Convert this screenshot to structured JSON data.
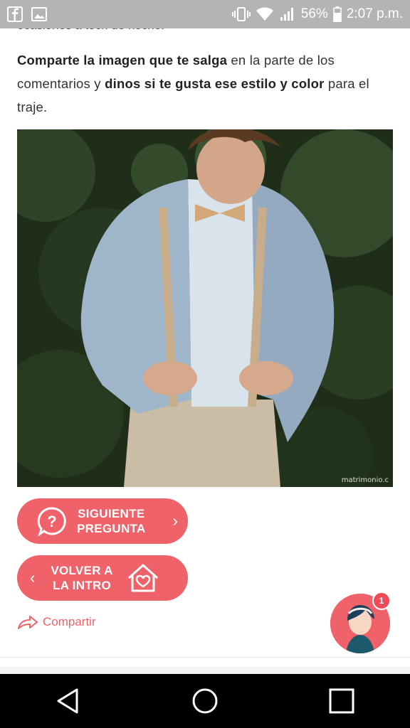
{
  "status_bar": {
    "network_percent": "56%",
    "time": "2:07 p.m."
  },
  "article": {
    "peek_text": "ocasiones a tech de noche.",
    "paragraph": {
      "part1_bold": "Comparte la imagen que te salga",
      "part2": " en la parte de los comentarios y ",
      "part3_bold": "dinos si te gusta ese estilo y color",
      "part4": " para el traje."
    },
    "photo_credit": "matrimonio.c"
  },
  "buttons": {
    "next_label": "SIGUIENTE\nPREGUNTA",
    "back_label": "VOLVER A\nLA INTRO",
    "share_label": "Compartir"
  },
  "chat": {
    "badge_count": "1"
  },
  "colors": {
    "accent": "#f0626a",
    "status_bar": "#b4b4b4"
  },
  "icons": [
    "facebook-icon",
    "gallery-icon",
    "vibrate-icon",
    "wifi-icon",
    "signal-icon",
    "battery-icon",
    "question-icon",
    "chevron-right-icon",
    "chevron-left-icon",
    "heart-house-icon",
    "share-icon",
    "back-nav-icon",
    "home-nav-icon",
    "recents-nav-icon"
  ]
}
